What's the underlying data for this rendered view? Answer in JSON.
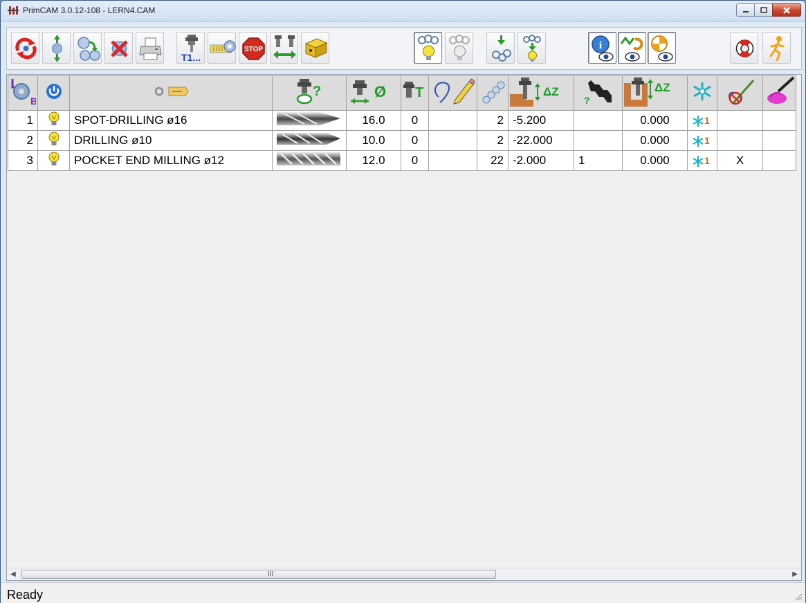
{
  "window": {
    "title": "PrimCAM 3.0.12-108  -  LERN4.CAM"
  },
  "toolbar": {
    "buttons": [
      {
        "icon": "refresh-cycle-icon"
      },
      {
        "icon": "move-up-down-icon"
      },
      {
        "icon": "duplicate-icon"
      },
      {
        "icon": "delete-icon"
      },
      {
        "icon": "print-icon"
      },
      {
        "icon": "tool-t1-icon",
        "label": "T1..."
      },
      {
        "icon": "tool-table-icon"
      },
      {
        "icon": "stop-icon",
        "label": "STOP"
      },
      {
        "icon": "tool-change-icon"
      },
      {
        "icon": "fixture-box-icon"
      },
      {
        "icon": "bulb-on-icon",
        "pressed": true
      },
      {
        "icon": "bulb-off-icon"
      },
      {
        "icon": "gears-down-icon"
      },
      {
        "icon": "gears-bulb-icon"
      },
      {
        "icon": "info-view-icon",
        "pressed": true
      },
      {
        "icon": "path-view-icon",
        "pressed": true
      },
      {
        "icon": "origin-view-icon",
        "pressed": true
      },
      {
        "icon": "lifebuoy-icon"
      },
      {
        "icon": "run-icon"
      }
    ]
  },
  "grid": {
    "columns": [
      {
        "icon": "op-sequence-icon"
      },
      {
        "icon": "power-icon"
      },
      {
        "icon": "operation-name-icon"
      },
      {
        "icon": "tool-query-icon"
      },
      {
        "icon": "tool-diameter-icon"
      },
      {
        "icon": "tool-number-icon"
      },
      {
        "icon": "edit-path-icon"
      },
      {
        "icon": "spiral-icon"
      },
      {
        "icon": "depth-delta-icon"
      },
      {
        "icon": "step-query-icon"
      },
      {
        "icon": "safe-delta-icon"
      },
      {
        "icon": "coolant-icon"
      },
      {
        "icon": "no-path-icon"
      },
      {
        "icon": "paint-icon"
      }
    ],
    "rows": [
      {
        "no": "1",
        "name": "SPOT-DRILLING ø16",
        "diameter": "16.0",
        "tool": "0",
        "passes": "2",
        "depth": "-5.200",
        "steps": "",
        "safe": "0.000",
        "coolant_sub": "1",
        "flag": ""
      },
      {
        "no": "2",
        "name": "DRILLING ø10",
        "diameter": "10.0",
        "tool": "0",
        "passes": "2",
        "depth": "-22.000",
        "steps": "",
        "safe": "0.000",
        "coolant_sub": "1",
        "flag": ""
      },
      {
        "no": "3",
        "name": "POCKET END MILLING  ø12",
        "diameter": "12.0",
        "tool": "0",
        "passes": "22",
        "depth": "-2.000",
        "steps": "1",
        "safe": "0.000",
        "coolant_sub": "1",
        "flag": "X"
      }
    ]
  },
  "scrollbar": {
    "grip": "III"
  },
  "status": {
    "text": "Ready"
  },
  "colors": {
    "accent_green": "#22aa22",
    "coolant_cyan": "#17b4c9",
    "header_green": "#1f9a2c",
    "stop_red": "#d42a1e"
  }
}
